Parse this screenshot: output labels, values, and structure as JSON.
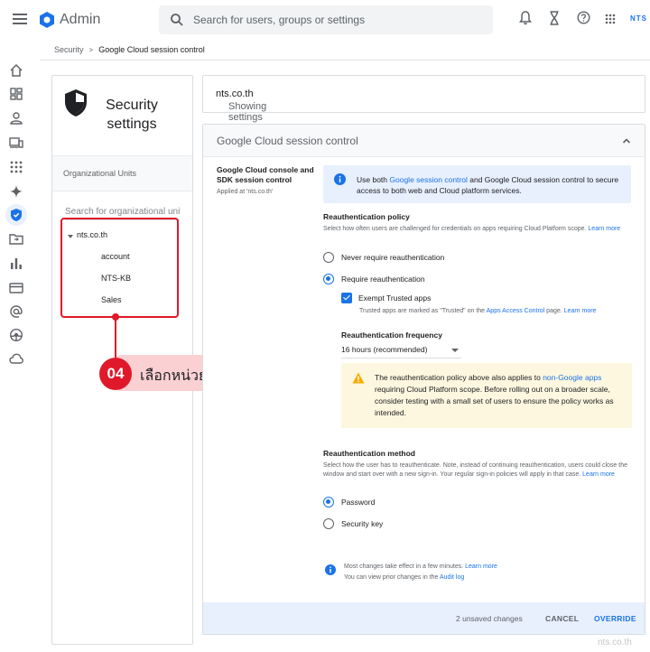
{
  "header": {
    "app_title": "Admin",
    "search_placeholder": "Search for users, groups or settings",
    "brand_mark": "NTS"
  },
  "breadcrumb": {
    "parent": "Security",
    "current": "Google Cloud session control"
  },
  "left_panel": {
    "title_line1": "Security",
    "title_line2": "settings",
    "ou_header": "Organizational Units",
    "ou_search_placeholder": "Search for organizational units",
    "tree": {
      "root": "nts.co.th",
      "children": [
        "account",
        "NTS-KB",
        "Sales"
      ]
    }
  },
  "annotation": {
    "number": "04",
    "text": "เลือกหน่วยงานที่ต้องการ",
    "color": "#e0192a"
  },
  "showing": {
    "prefix": "Showing settings for users in ",
    "domain": "nts.co.th"
  },
  "card": {
    "title": "Google Cloud session control",
    "setting_name": "Google Cloud console and SDK session control",
    "applied_at": "Applied at 'nts.co.th'",
    "info": {
      "pre": "Use both ",
      "link": "Google session control",
      "post": " and Google Cloud session control to secure access to both web and Cloud platform services."
    },
    "reauth_policy": {
      "heading": "Reauthentication policy",
      "description": "Select how often users are challenged for credentials on apps requiring Cloud Platform scope.",
      "learn_more": "Learn more",
      "options": [
        "Never require reauthentication",
        "Require reauthentication"
      ],
      "selected": "Require reauthentication",
      "exempt_label": "Exempt Trusted apps",
      "exempt_checked": true,
      "exempt_note_pre": "Trusted apps are marked as \"Trusted\" on the ",
      "exempt_note_link": "Apps Access Control",
      "exempt_note_post": " page.",
      "exempt_learn_more": "Learn more"
    },
    "frequency": {
      "heading": "Reauthentication frequency",
      "value": "16 hours (recommended)"
    },
    "warning": {
      "pre": "The reauthentication policy above also applies to ",
      "link": "non-Google apps",
      "post": " requiring Cloud Platform scope. Before rolling out on a broader scale, consider testing with a small set of users to ensure the policy works as intended."
    },
    "reauth_method": {
      "heading": "Reauthentication method",
      "description": "Select how the user has to reauthenticate. Note, instead of continuing reauthentication, users could close the window and start over with a new sign-in. Your regular sign-in policies will apply in that case.",
      "learn_more": "Learn more",
      "options": [
        "Password",
        "Security key"
      ],
      "selected": "Password"
    },
    "footer": {
      "line1": "Most changes take effect in a few minutes.",
      "line1_link": "Learn more",
      "line2": "You can view prior changes in the ",
      "line2_link": "Audit log"
    },
    "actions": {
      "unsaved": "2 unsaved changes",
      "cancel": "CANCEL",
      "override": "OVERRIDE"
    }
  },
  "watermark": "nts.co.th",
  "colors": {
    "accent": "#1a73e8",
    "annotation": "#e0192a",
    "info_bg": "#e8f0fe",
    "warning_bg": "#fef7e0"
  }
}
